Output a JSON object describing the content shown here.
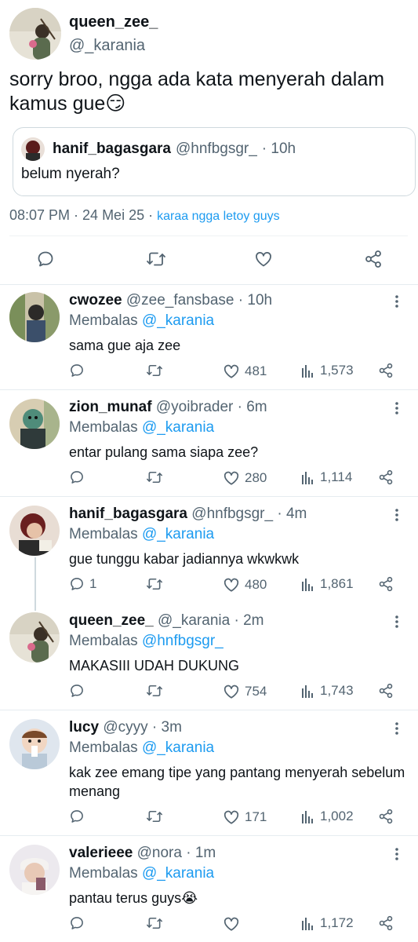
{
  "main": {
    "name": "queen_zee_",
    "handle": "@_karania",
    "text": "sorry broo, ngga ada kata menyerah dalam kamus gue😏",
    "quote": {
      "name": "hanif_bagasgara",
      "handle": "@hnfbgsgr_",
      "time": "· 10h",
      "text": "belum nyerah?"
    },
    "time": "08:07 PM · 24 Mei 25 · ",
    "source": "karaa ngga letoy guys"
  },
  "replies": [
    {
      "name": "cwozee",
      "handle": "@zee_fansbase",
      "time": "· 10h",
      "replying_label": "Membalas",
      "replying_to": "@_karania",
      "text": "sama gue aja zee",
      "comments": "",
      "likes": "481",
      "views": "1,573"
    },
    {
      "name": "zion_munaf",
      "handle": "@yoibrader",
      "time": "· 6m",
      "replying_label": "Membalas",
      "replying_to": "@_karania",
      "text": "entar pulang sama siapa zee?",
      "comments": "",
      "likes": "280",
      "views": "1,114"
    },
    {
      "name": "hanif_bagasgara",
      "handle": "@hnfbgsgr_",
      "time": "· 4m",
      "replying_label": "Membalas",
      "replying_to": "@_karania",
      "text": "gue tunggu kabar jadiannya wkwkwk",
      "comments": "1",
      "likes": "480",
      "views": "1,861"
    },
    {
      "name": "queen_zee_",
      "handle": "@_karania",
      "time": "· 2m",
      "replying_label": "Membalas",
      "replying_to": "@hnfbgsgr_",
      "text": "MAKASIII UDAH DUKUNG",
      "comments": "",
      "likes": "754",
      "views": "1,743"
    },
    {
      "name": "lucy",
      "handle": "@cyyy",
      "time": "· 3m",
      "replying_label": "Membalas",
      "replying_to": "@_karania",
      "text": "kak zee emang tipe yang pantang menyerah sebelum menang",
      "comments": "",
      "likes": "171",
      "views": "1,002"
    },
    {
      "name": "valerieee",
      "handle": "@nora",
      "time": "· 1m",
      "replying_label": "Membalas",
      "replying_to": "@_karania",
      "text": "pantau terus guys😭",
      "comments": "",
      "likes": "",
      "views": "1,172"
    }
  ],
  "icons": {
    "reply": "comment-icon",
    "retweet": "retweet-icon",
    "like": "heart-icon",
    "views": "views-icon",
    "share": "share-icon",
    "more": "more-vertical-icon"
  },
  "colors": {
    "link": "#1d9bf0",
    "secondary": "#536471",
    "border": "#cfd9de"
  }
}
